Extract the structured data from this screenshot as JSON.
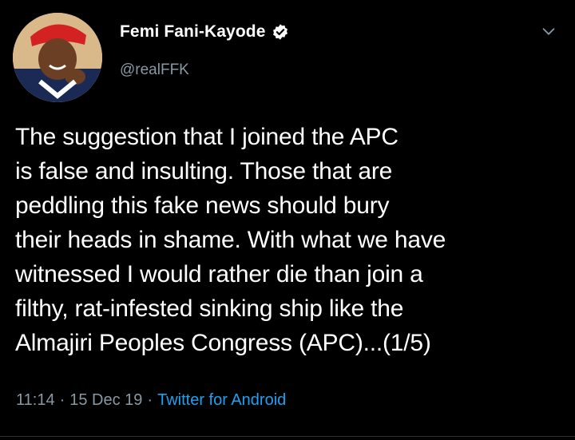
{
  "tweet": {
    "display_name": "Femi Fani-Kayode",
    "handle": "@realFFK",
    "verified_icon": "verified-badge-icon",
    "menu_icon": "chevron-down-icon",
    "body": "The suggestion that I joined the APC\nis false and insulting. Those that are\npeddling this fake news should bury\ntheir heads in shame. With what we have\nwitnessed I would rather die than join a\nfilthy, rat-infested sinking ship like the\nAlmajiri Peoples Congress (APC)...(1/5)",
    "time": "11:14",
    "date": "15 Dec 19",
    "separator": "·",
    "source": "Twitter for Android"
  },
  "colors": {
    "background": "#000000",
    "text_primary": "#ffffff",
    "text_secondary": "#8899a6",
    "link": "#1da1f2"
  }
}
